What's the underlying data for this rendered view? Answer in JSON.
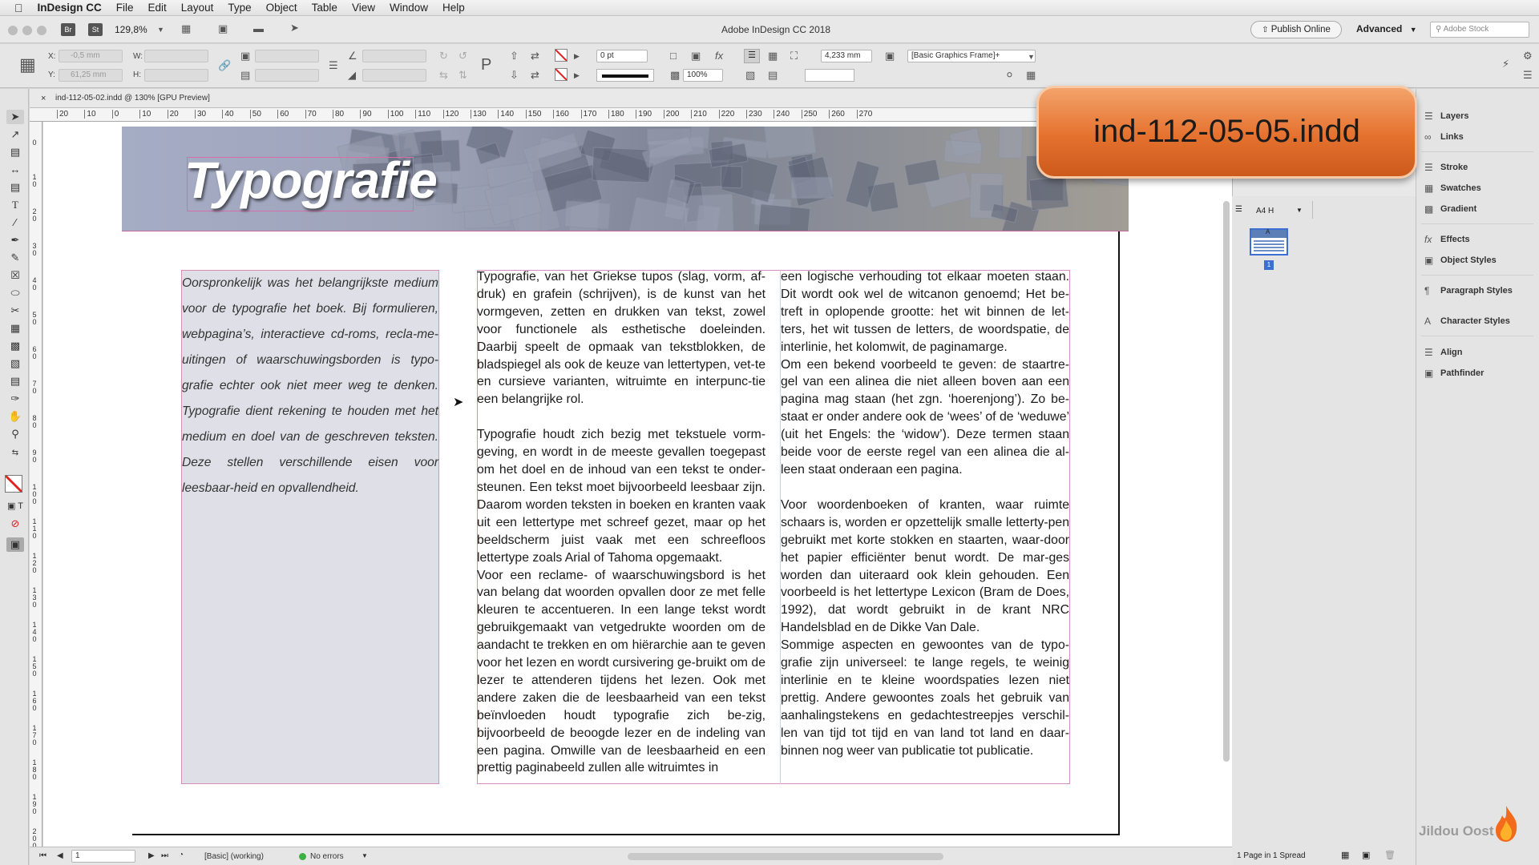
{
  "mac_menu": {
    "apple": "",
    "app": "InDesign CC",
    "items": [
      "File",
      "Edit",
      "Layout",
      "Type",
      "Object",
      "Table",
      "View",
      "Window",
      "Help"
    ]
  },
  "app_bar": {
    "br": "Br",
    "st": "St",
    "zoom": "129,8%",
    "window_title": "Adobe InDesign CC 2018",
    "publish": "Publish Online",
    "workspace": "Advanced",
    "stock_placeholder": "Adobe Stock"
  },
  "control": {
    "x_label": "X:",
    "x_value": "-0,5 mm",
    "y_label": "Y:",
    "y_value": "61,25 mm",
    "w_label": "W:",
    "h_label": "H:",
    "stroke_weight": "0 pt",
    "opacity": "100%",
    "gap": "4,233 mm",
    "object_style": "[Basic Graphics Frame]+"
  },
  "doc_tab": {
    "name": "ind-112-05-02.indd @ 130% [GPU Preview]"
  },
  "ruler_labels": [
    "20",
    "10",
    "0",
    "10",
    "20",
    "30",
    "40",
    "50",
    "60",
    "70",
    "80",
    "90",
    "100",
    "110",
    "120",
    "130",
    "140",
    "150",
    "160",
    "170",
    "180",
    "190",
    "200",
    "210",
    "220",
    "230",
    "240",
    "250",
    "260",
    "270"
  ],
  "vruler_labels": [
    "0",
    "10",
    "20",
    "30",
    "40",
    "50",
    "60",
    "70",
    "80",
    "90",
    "100",
    "110",
    "120",
    "130",
    "140",
    "150",
    "160",
    "170",
    "180",
    "190",
    "200"
  ],
  "page": {
    "title": "Typografie",
    "col1": "Oorspronkelijk was het belangrijkste medium voor de typografie het boek.  Bij formulieren, webpagina’s, interactieve cd-roms, recla-me-uitingen of waarschuwingsborden is typo-grafie echter ook niet meer weg te denken. Typografie dient rekening te houden met het medium en doel van de geschreven teksten. Deze stellen verschillende eisen voor leesbaar-heid en opvallendheid.",
    "col2": [
      "Typografie, van het Griekse tupos (slag, vorm, af-druk) en grafein (schrijven), is de kunst van het vormgeven, zetten en drukken van tekst, zowel voor functionele als esthetische doeleinden. Daarbij speelt de opmaak van tekstblokken, de bladspiegel als ook de keuze van lettertypen, vet-te en cursieve varianten, witruimte en interpunc-tie een belangrijke rol.",
      "Typografie houdt zich bezig met tekstuele vorm-geving, en wordt in de meeste gevallen toegepast om het doel en de inhoud van een tekst te onder-steunen. Een tekst moet bijvoorbeeld leesbaar zijn. Daarom worden teksten in boeken en kranten vaak uit een lettertype met schreef gezet, maar op het beeldscherm juist vaak met een schreefloos lettertype zoals Arial of Tahoma opgemaakt.",
      "Voor een reclame- of waarschuwingsbord is het van belang dat woorden opvallen door ze met felle kleuren te accentueren. In een lange tekst wordt gebruikgemaakt van vetgedrukte woorden om de aandacht te trekken en om hiërarchie aan te geven voor het lezen en wordt cursivering ge-bruikt om de lezer te attenderen tijdens het lezen. Ook met andere zaken die de leesbaarheid van een tekst beïnvloeden houdt typografie zich be-zig, bijvoorbeeld de beoogde lezer en de indeling van een pagina. Omwille van de leesbaarheid en een prettig paginabeeld zullen alle witruimtes in"
    ],
    "col3": [
      "een logische verhouding tot elkaar moeten staan. Dit wordt ook wel de witcanon genoemd; Het be-treft in oplopende grootte: het wit binnen de let-ters, het wit tussen de letters, de woordspatie, de interlinie, het kolomwit, de paginamarge.",
      "Om een bekend voorbeeld te geven: de staartre-gel van een alinea die niet alleen boven aan een pagina mag staan (het zgn. ‘hoerenjong’). Zo be-staat er onder andere ook de ‘wees’ of de ‘weduwe’ (uit het Engels: the ‘widow’). Deze termen staan beide voor de eerste regel van een alinea die al-leen staat onderaan een pagina.",
      "Voor woordenboeken of kranten, waar ruimte schaars is, worden er opzettelijk smalle letterty-pen gebruikt met korte stokken en staarten, waar-door het papier efficiënter benut wordt. De mar-ges worden dan uiteraard ook klein gehouden. Een voorbeeld is het lettertype Lexicon (Bram de Does, 1992), dat wordt gebruikt in de krant NRC Handelsblad en de Dikke Van Dale.",
      "Sommige aspecten en gewoontes van de typo-grafie zijn universeel: te lange regels, te weinig interlinie en te kleine woordspaties lezen niet prettig. Andere gewoontes zoals het gebruik van aanhalingstekens en gedachtestreepjes verschil-len van tijd tot tijd en van land tot land en daar-binnen nog weer van publicatie tot publicatie."
    ]
  },
  "pages_panel": {
    "master": "A4 H",
    "page_label": "A",
    "page_number": "1",
    "footer": "1 Page in 1 Spread"
  },
  "dock": {
    "items": [
      "Layers",
      "Links",
      "Stroke",
      "Swatches",
      "Gradient",
      "Effects",
      "Object Styles",
      "Paragraph Styles",
      "Character Styles",
      "Align",
      "Pathfinder"
    ],
    "icons": [
      "layers-icon",
      "links-icon",
      "stroke-icon",
      "swatches-icon",
      "gradient-icon",
      "effects-icon",
      "object-styles-icon",
      "paragraph-styles-icon",
      "character-styles-icon",
      "align-icon",
      "pathfinder-icon"
    ]
  },
  "status": {
    "page": "1",
    "profile": "[Basic] (working)",
    "errors": "No errors"
  },
  "callout": {
    "text": "ind-112-05-05.indd"
  },
  "watermark": {
    "text": "Jildou Oost"
  },
  "colors": {
    "frame_edge": "#d98cbf",
    "callout": "#e5712e",
    "banner": "#9ea3b8",
    "status_ok": "#3cb043"
  }
}
